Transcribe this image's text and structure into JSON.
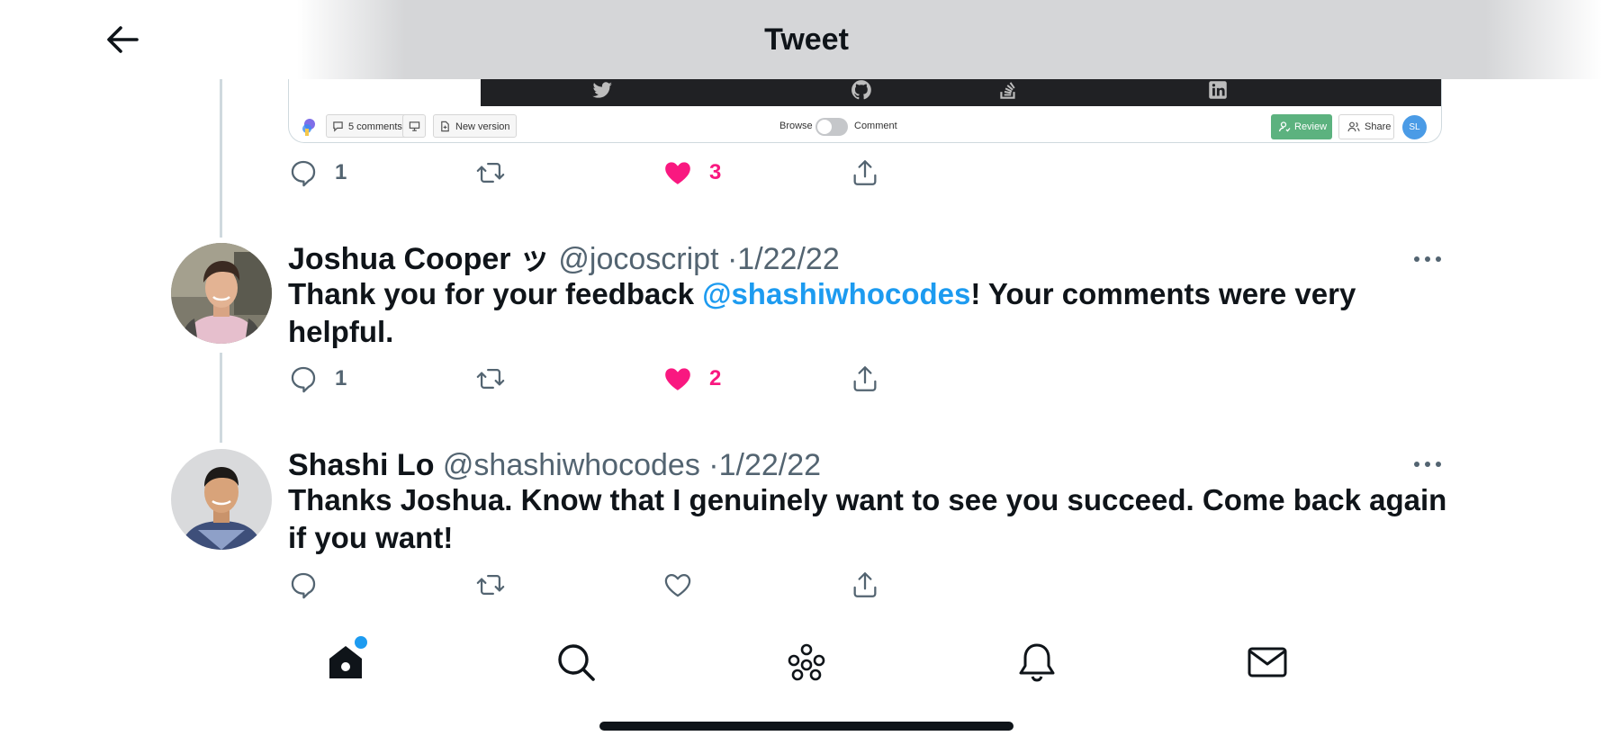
{
  "header": {
    "title": "Tweet"
  },
  "embed": {
    "comments_label": "5 comments",
    "new_version_label": "New version",
    "browse_label": "Browse",
    "comment_label": "Comment",
    "review_label": "Review",
    "share_label": "Share",
    "avatar_initials": "SL"
  },
  "parent_actions": {
    "replies": "1",
    "likes": "3"
  },
  "tweets": [
    {
      "name": "Joshua Cooper ッ",
      "handle": "@jocoscript",
      "separator": "·",
      "date": "1/22/22",
      "text_before": "Thank you for your feedback ",
      "mention": "@shashiwhocodes",
      "text_after": "! Your comments were very helpful.",
      "replies": "1",
      "likes": "2",
      "liked": true
    },
    {
      "name": "Shashi Lo",
      "handle": "@shashiwhocodes",
      "separator": "·",
      "date": "1/22/22",
      "text": "Thanks Joshua. Know that I genuinely want to see you succeed. Come back again if you want!",
      "liked": false
    }
  ],
  "icons": [
    "back-arrow-icon",
    "reply-icon",
    "retweet-icon",
    "heart-icon",
    "share-icon",
    "more-icon",
    "home-icon",
    "search-icon",
    "spaces-icon",
    "notifications-icon",
    "messages-icon"
  ],
  "colors": {
    "accent": "#1d9bf0",
    "like": "#f91880",
    "muted": "#536471",
    "text": "#0f1419"
  }
}
